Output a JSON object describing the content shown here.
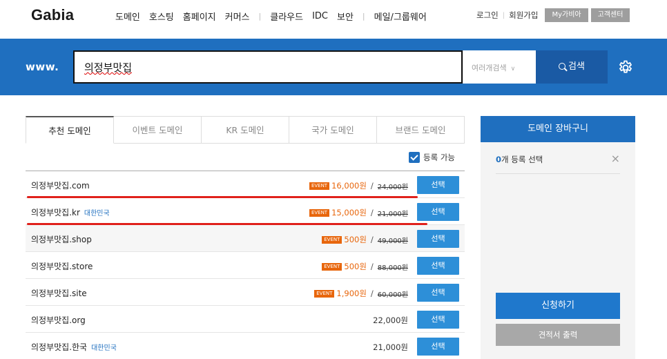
{
  "nav": {
    "logo": "Gabia",
    "menu": [
      "도메인",
      "호스팅",
      "홈페이지",
      "커머스",
      "|",
      "클라우드",
      "IDC",
      "보안",
      "|",
      "메일/그룹웨어"
    ],
    "util": {
      "login": "로그인",
      "join": "회원가입",
      "mygabia": "My가비아",
      "support": "고객센터"
    }
  },
  "search": {
    "prefix": "www.",
    "query": "의정부맛집",
    "multi_label": "여러개검색",
    "button_label": "검색"
  },
  "tabs": [
    {
      "label": "추천 도메인",
      "active": true
    },
    {
      "label": "이벤트 도메인",
      "active": false
    },
    {
      "label": "KR 도메인",
      "active": false
    },
    {
      "label": "국가 도메인",
      "active": false
    },
    {
      "label": "브랜드 도메인",
      "active": false
    }
  ],
  "filter": {
    "available_label": "등록 가능",
    "checked": true
  },
  "results": [
    {
      "name": "의정부맛집.com",
      "tag": "",
      "event": true,
      "event_label": "EVENT",
      "price": "16,000원",
      "original": "24,000원",
      "select": "선택",
      "highlight": false,
      "underlined": true
    },
    {
      "name": "의정부맛집.kr",
      "tag": "대한민국",
      "event": true,
      "event_label": "EVENT",
      "price": "15,000원",
      "original": "21,000원",
      "select": "선택",
      "highlight": false,
      "underlined": true
    },
    {
      "name": "의정부맛집.shop",
      "tag": "",
      "event": true,
      "event_label": "EVENT",
      "price": "500원",
      "original": "49,000원",
      "select": "선택",
      "highlight": true,
      "underlined": false
    },
    {
      "name": "의정부맛집.store",
      "tag": "",
      "event": true,
      "event_label": "EVENT",
      "price": "500원",
      "original": "88,000원",
      "select": "선택",
      "highlight": false,
      "underlined": false
    },
    {
      "name": "의정부맛집.site",
      "tag": "",
      "event": true,
      "event_label": "EVENT",
      "price": "1,900원",
      "original": "60,000원",
      "select": "선택",
      "highlight": false,
      "underlined": false
    },
    {
      "name": "의정부맛집.org",
      "tag": "",
      "event": false,
      "event_label": "",
      "price": "22,000원",
      "original": "",
      "select": "선택",
      "highlight": false,
      "underlined": false
    },
    {
      "name": "의정부맛집.한국",
      "tag": "대한민국",
      "event": false,
      "event_label": "",
      "price": "21,000원",
      "original": "",
      "select": "선택",
      "highlight": false,
      "underlined": false
    }
  ],
  "cart": {
    "title": "도메인 장바구니",
    "count": "0",
    "count_suffix": "개 등록 선택",
    "close": "×",
    "apply_label": "신청하기",
    "quote_label": "견적서 출력"
  },
  "colors": {
    "brand_blue": "#1f6fbf",
    "event_orange": "#e8660c",
    "select_button": "#2d8fd8",
    "annotation_red": "#e0201b"
  },
  "icons": {
    "search": "magnifier-icon",
    "settings": "gear-icon",
    "checkbox": "check-icon"
  }
}
